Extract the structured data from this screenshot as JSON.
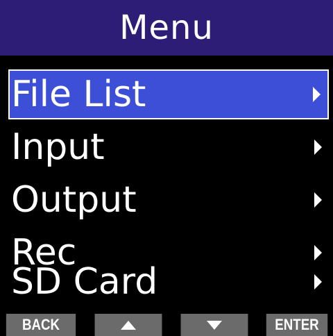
{
  "header": {
    "title": "Menu"
  },
  "menu": {
    "items": [
      {
        "label": "File List",
        "selected": true,
        "icon": "chevron-right-icon"
      },
      {
        "label": "Input",
        "selected": false,
        "icon": "chevron-right-icon"
      },
      {
        "label": "Output",
        "selected": false,
        "icon": "chevron-right-icon"
      },
      {
        "label": "Rec",
        "selected": false,
        "icon": "chevron-right-icon"
      },
      {
        "label": "SD Card",
        "selected": false,
        "icon": "chevron-right-icon"
      }
    ]
  },
  "softkeys": {
    "back": "BACK",
    "up_icon": "up-arrow-icon",
    "down_icon": "down-arrow-icon",
    "enter": "ENTER"
  },
  "colors": {
    "title_bar": "#2e1d77",
    "selection": "#3d4fd6",
    "softkey": "#6b6b6b",
    "background": "#000000",
    "text": "#ffffff"
  }
}
